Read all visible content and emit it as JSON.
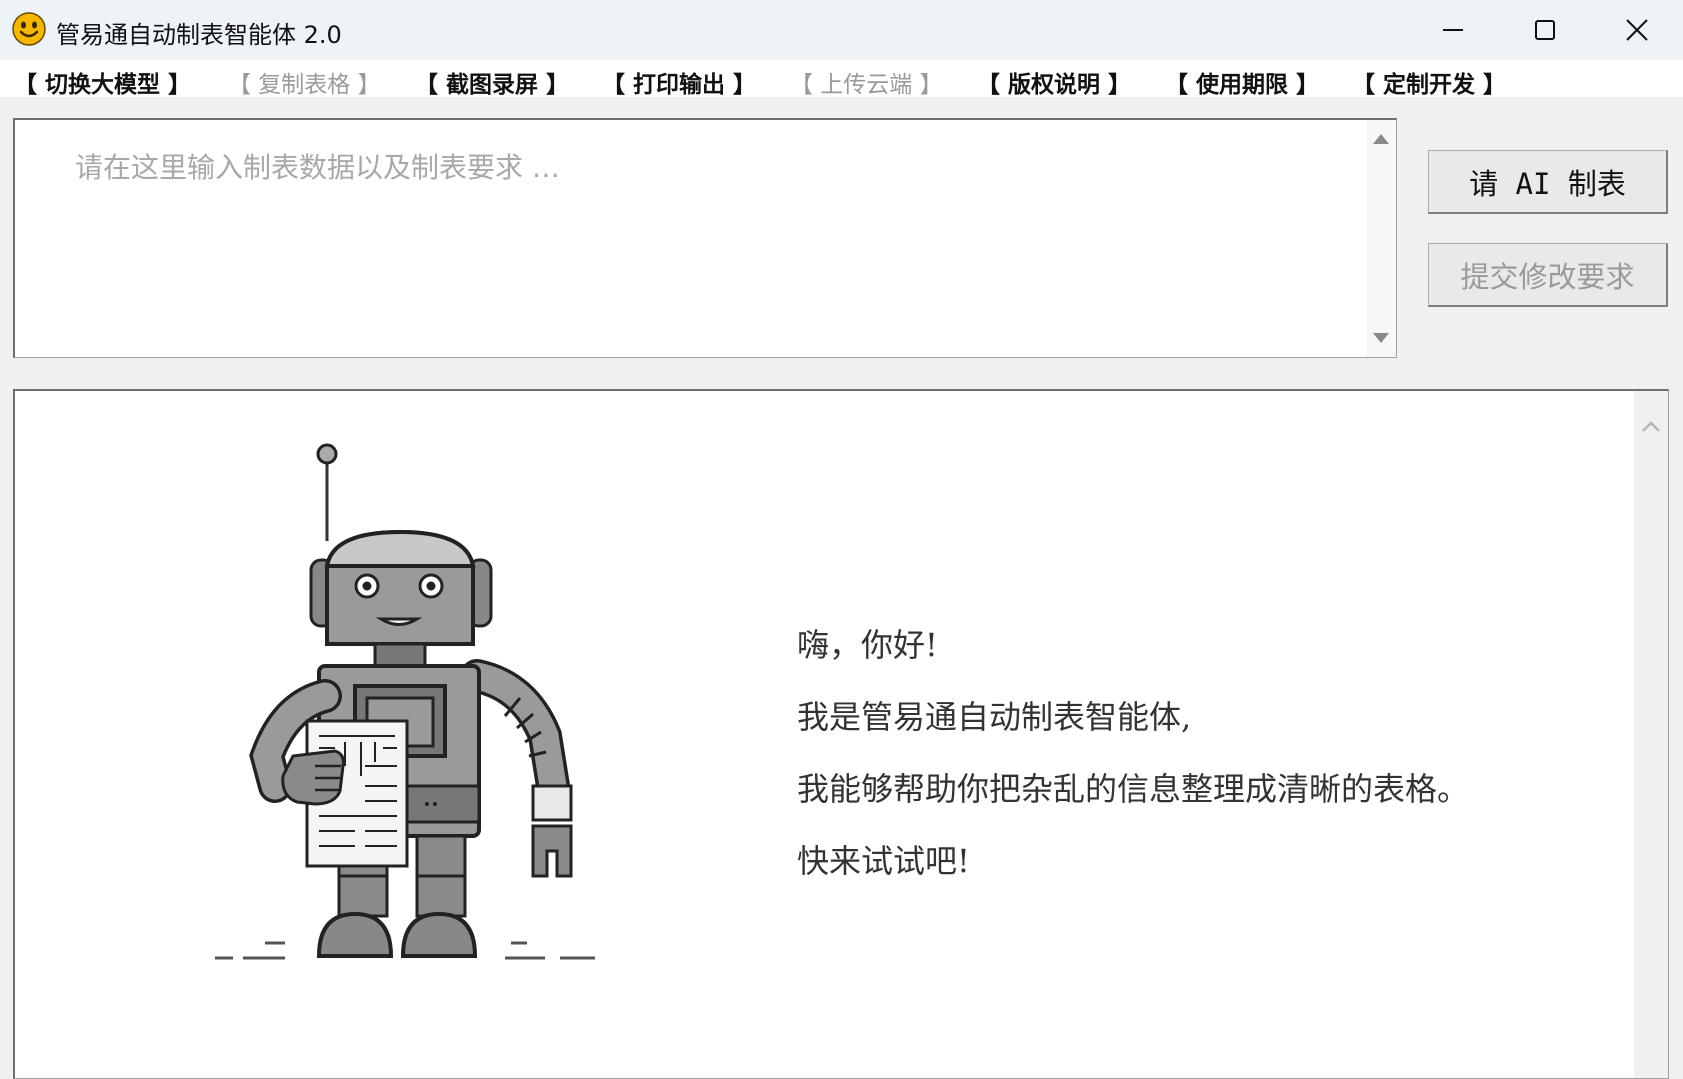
{
  "window": {
    "title": "管易通自动制表智能体 2.0",
    "controls": [
      "minimize",
      "maximize",
      "close"
    ]
  },
  "menu": [
    {
      "label": "【 切换大模型 】",
      "enabled": true
    },
    {
      "label": "【 复制表格 】",
      "enabled": false
    },
    {
      "label": "【 截图录屏 】",
      "enabled": true
    },
    {
      "label": "【 打印输出 】",
      "enabled": true
    },
    {
      "label": "【 上传云端 】",
      "enabled": false
    },
    {
      "label": "【 版权说明 】",
      "enabled": true
    },
    {
      "label": "【 使用期限 】",
      "enabled": true
    },
    {
      "label": "【 定制开发 】",
      "enabled": true
    }
  ],
  "input": {
    "placeholder": "请在这里输入制表数据以及制表要求 …",
    "value": ""
  },
  "buttons": {
    "generate": "请 AI 制表",
    "revise": "提交修改要求"
  },
  "output": {
    "greeting": " 嗨，你好!",
    "line1": "我是管易通自动制表智能体,",
    "line2": "我能够帮助你把杂乱的信息整理成清晰的表格。",
    "line3": "快来试试吧!"
  },
  "colors": {
    "titlebar_bg": "#eef3f7",
    "window_bg": "#f0f0f0",
    "disabled_text": "#9a9a9a",
    "smiley_yellow": "#f5b800"
  },
  "icons": {
    "app": "smiley-face-icon",
    "minimize": "minimize-icon",
    "maximize": "maximize-icon",
    "close": "close-icon",
    "illustration": "robot-holding-table-illustration"
  }
}
